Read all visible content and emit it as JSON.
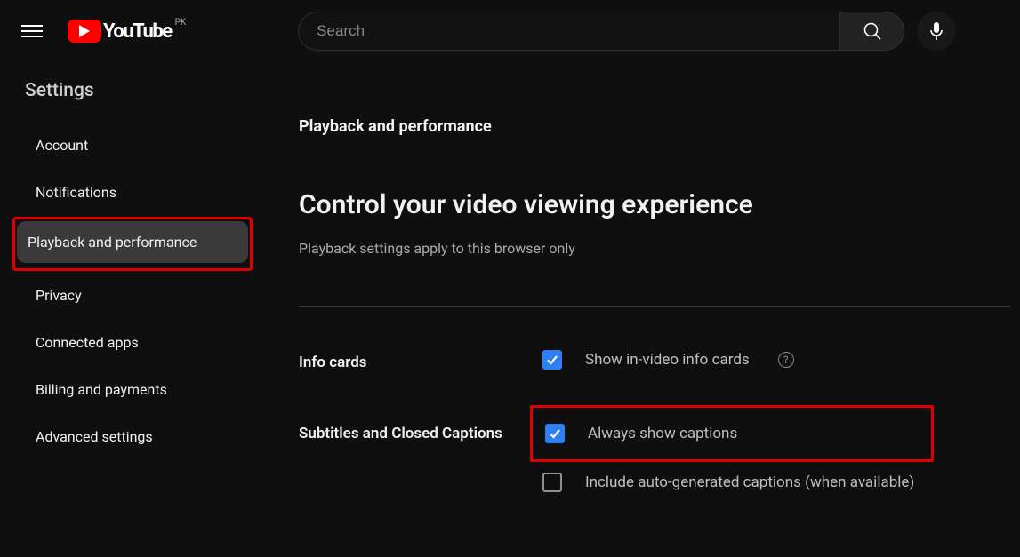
{
  "header": {
    "logo_text": "YouTube",
    "country": "PK",
    "search_placeholder": "Search"
  },
  "sidebar": {
    "title": "Settings",
    "items": [
      {
        "label": "Account"
      },
      {
        "label": "Notifications"
      },
      {
        "label": "Playback and performance"
      },
      {
        "label": "Privacy"
      },
      {
        "label": "Connected apps"
      },
      {
        "label": "Billing and payments"
      },
      {
        "label": "Advanced settings"
      }
    ]
  },
  "main": {
    "section_heading": "Playback and performance",
    "title": "Control your video viewing experience",
    "subtitle": "Playback settings apply to this browser only",
    "rows": {
      "info_cards": {
        "label": "Info cards",
        "opt1": "Show in-video info cards"
      },
      "captions": {
        "label": "Subtitles and Closed Captions",
        "opt1": "Always show captions",
        "opt2": "Include auto-generated captions (when available)"
      }
    },
    "help_tooltip": "?"
  }
}
